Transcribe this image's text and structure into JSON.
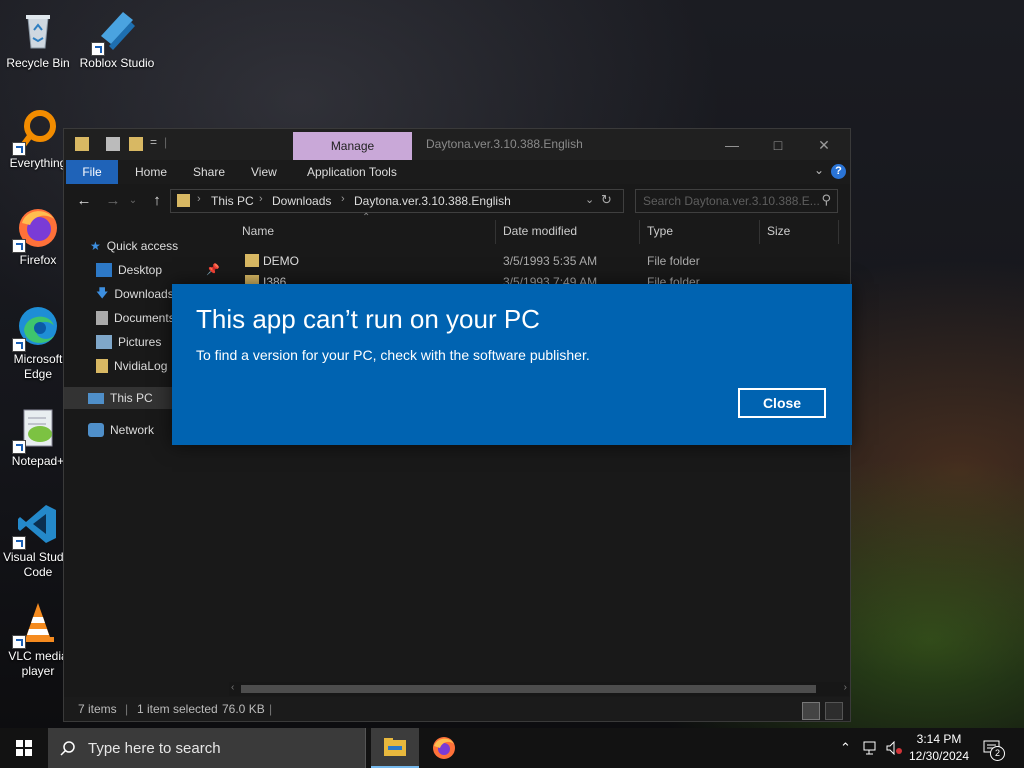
{
  "desktop": {
    "icons": [
      {
        "label": "Recycle Bin"
      },
      {
        "label": "Roblox Studio"
      },
      {
        "label": "Everything"
      },
      {
        "label": "Firefox"
      },
      {
        "label": "Microsoft Edge"
      },
      {
        "label": "Notepad+"
      },
      {
        "label": "Visual Studio Code"
      },
      {
        "label": "VLC media player"
      }
    ]
  },
  "explorer": {
    "manage_tab": "Manage",
    "window_title": "Daytona.ver.3.10.388.English",
    "ribbon": {
      "file": "File",
      "home": "Home",
      "share": "Share",
      "view": "View",
      "app_tools": "Application Tools"
    },
    "breadcrumb": [
      "This PC",
      "Downloads",
      "Daytona.ver.3.10.388.English"
    ],
    "search_placeholder": "Search Daytona.ver.3.10.388.E...",
    "nav": {
      "quick_access": "Quick access",
      "desktop": "Desktop",
      "downloads": "Downloads",
      "documents": "Documents",
      "pictures": "Pictures",
      "nvidialog": "NvidiaLog",
      "this_pc": "This PC",
      "network": "Network"
    },
    "columns": {
      "name": "Name",
      "date": "Date modified",
      "type": "Type",
      "size": "Size"
    },
    "rows": [
      {
        "name": "DEMO",
        "date": "3/5/1993 5:35 AM",
        "type": "File folder"
      },
      {
        "name": "I386",
        "date": "3/5/1993 7:49 AM",
        "type": "File folder"
      }
    ],
    "status": {
      "items": "7 items",
      "selected": "1 item selected",
      "size": "76.0 KB"
    }
  },
  "dialog": {
    "title": "This app can’t run on your PC",
    "message": "To find a version for your PC, check with the software publisher.",
    "close_label": "Close"
  },
  "taskbar": {
    "search_placeholder": "Type here to search",
    "time": "3:14 PM",
    "date": "12/30/2024",
    "notification_count": "2"
  },
  "colors": {
    "dialog_bg": "#0063b1",
    "accent": "#1f63b8",
    "manage_tab": "#c9a8d8"
  }
}
